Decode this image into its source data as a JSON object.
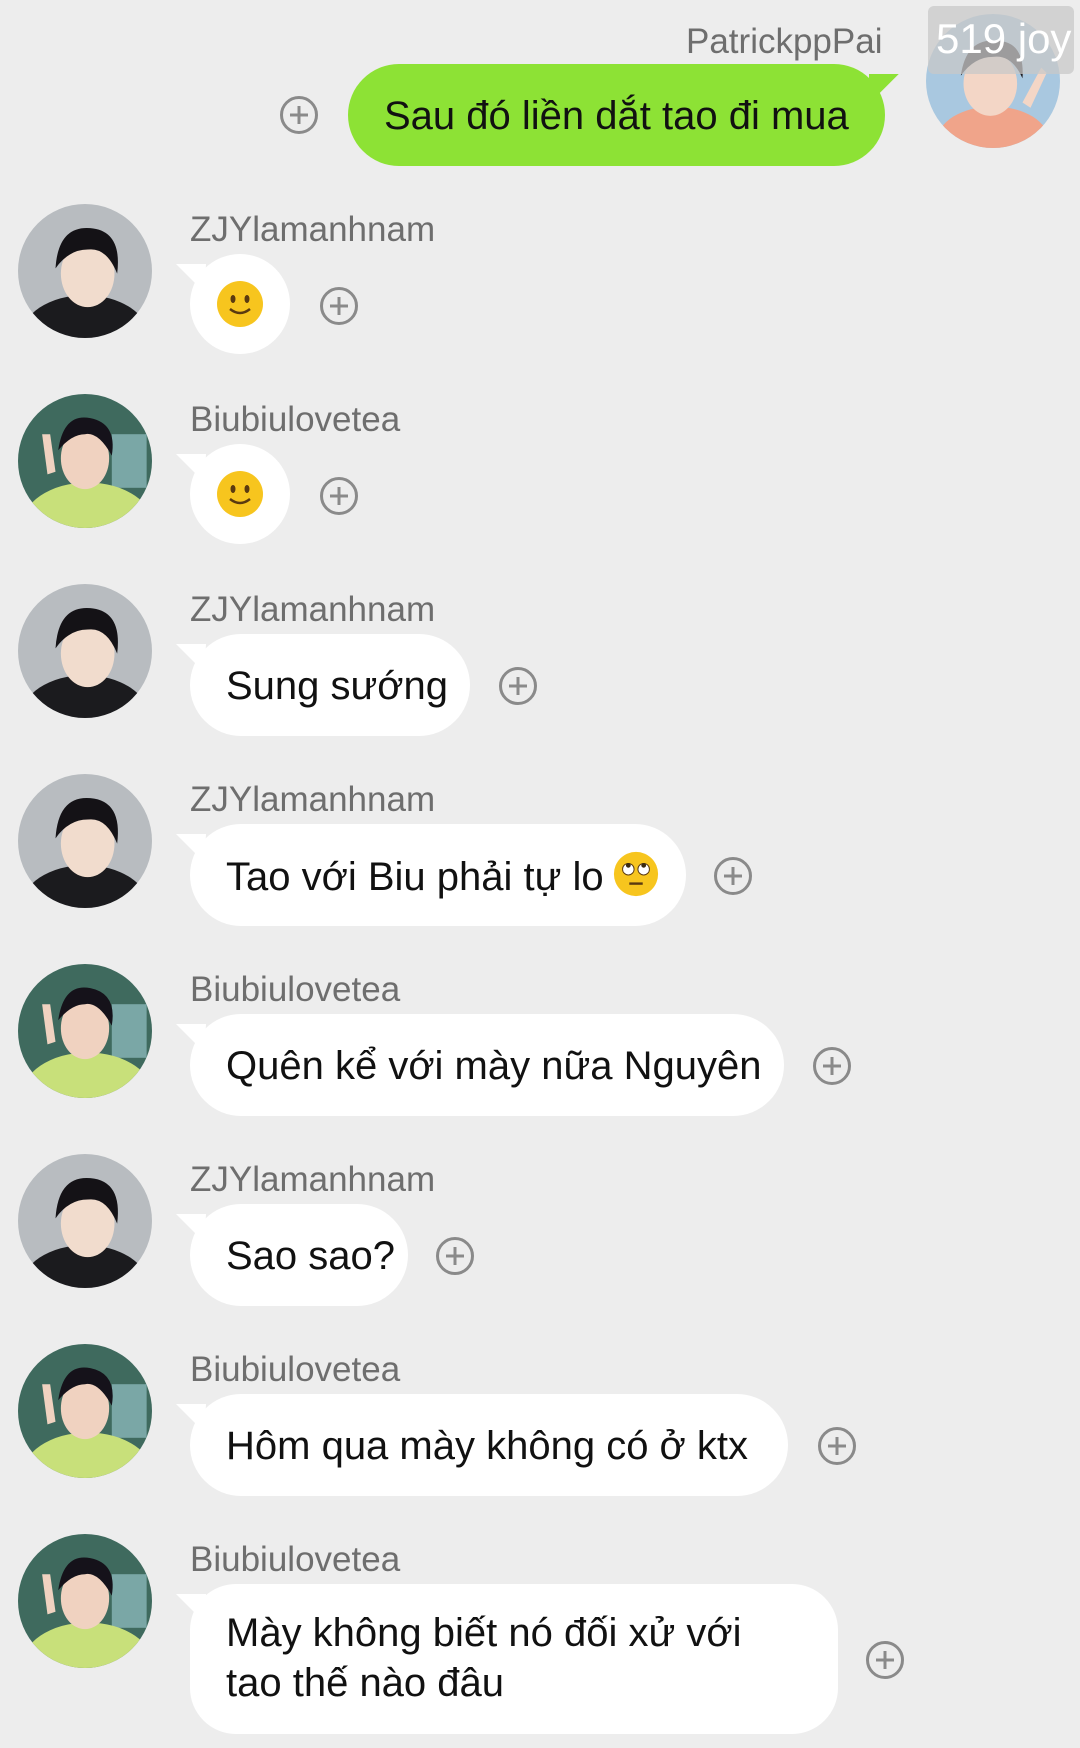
{
  "self_message": {
    "sender": "PatrickppPai",
    "text": "Sau đó liền dắt tao đi mua",
    "watermark": "519 joy"
  },
  "messages": [
    {
      "sender": "ZJYlamanhnam",
      "text": "",
      "emoji": "slightly-smiling-face"
    },
    {
      "sender": "Biubiulovetea",
      "text": "",
      "emoji": "slightly-smiling-face"
    },
    {
      "sender": "ZJYlamanhnam",
      "text": "Sung sướng"
    },
    {
      "sender": "ZJYlamanhnam",
      "text": "Tao với Biu phải tự lo",
      "emoji": "rolling-eyes-face"
    },
    {
      "sender": "Biubiulovetea",
      "text": "Quên kể với mày nữa Nguyên"
    },
    {
      "sender": "ZJYlamanhnam",
      "text": "Sao sao?"
    },
    {
      "sender": "Biubiulovetea",
      "text": "Hôm qua mày không có ở ktx"
    },
    {
      "sender": "Biubiulovetea",
      "text": "Mày không biết nó đối xử với tao thế nào đâu"
    }
  ],
  "colors": {
    "background": "#ededed",
    "self_bubble": "#8de235",
    "other_bubble": "#ffffff",
    "name_text": "#6e6e6e"
  },
  "icons": {
    "add_reaction": "plus-circle-icon",
    "avatar_zjy": "avatar-dark-jacket",
    "avatar_biu": "avatar-green-sweater"
  }
}
